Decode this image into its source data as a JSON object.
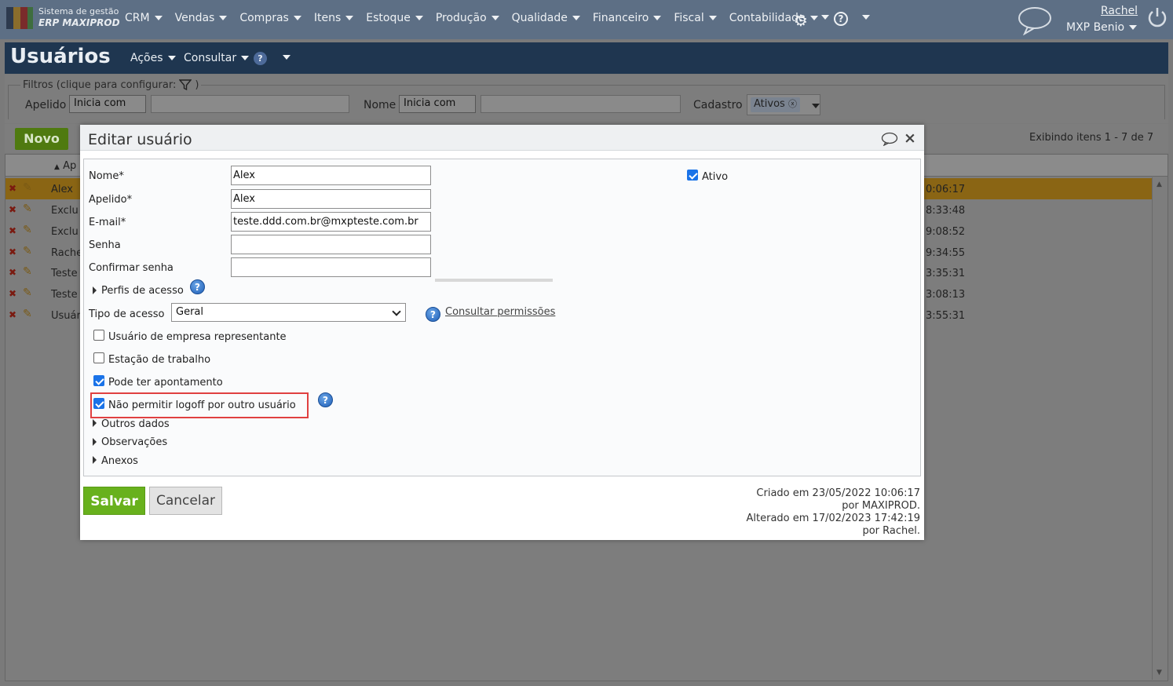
{
  "brand": {
    "line1": "Sistema de gestão",
    "line2": "ERP MAXIPROD"
  },
  "nav": [
    "CRM",
    "Vendas",
    "Compras",
    "Itens",
    "Estoque",
    "Produção",
    "Qualidade",
    "Financeiro",
    "Fiscal",
    "Contabilidade"
  ],
  "user": {
    "name": "Rachel",
    "company": "MXP Benio"
  },
  "page": {
    "title": "Usuários",
    "acoes": "Ações",
    "consultar": "Consultar"
  },
  "filters": {
    "legend": "Filtros (clique para configurar:",
    "legend_end": ")",
    "apelido_label": "Apelido",
    "apelido_op": "Inicia com",
    "nome_label": "Nome",
    "nome_op": "Inicia com",
    "cadastro_label": "Cadastro",
    "cadastro_tag": "Ativos"
  },
  "grid": {
    "novo": "Novo",
    "exibindo": "Exibindo itens 1 - 7 de 7",
    "sort_col": "Ap",
    "rows": [
      {
        "name": "Alex",
        "time": "0:06:17"
      },
      {
        "name": "Exclu",
        "time": "8:33:48"
      },
      {
        "name": "Exclu",
        "time": "9:08:52"
      },
      {
        "name": "Rache",
        "time": "9:34:55"
      },
      {
        "name": "Teste",
        "time": "3:35:31"
      },
      {
        "name": "Teste",
        "time": "3:08:13"
      },
      {
        "name": "Usuár",
        "time": "3:55:31"
      }
    ]
  },
  "modal": {
    "title": "Editar usuário",
    "fields": {
      "nome_label": "Nome*",
      "nome_value": "Alex",
      "apelido_label": "Apelido*",
      "apelido_value": "Alex",
      "email_label": "E-mail*",
      "email_value": "teste.ddd.com.br@mxpteste.com.br",
      "senha_label": "Senha",
      "senha_value": "",
      "confirmar_label": "Confirmar senha",
      "confirmar_value": ""
    },
    "ativo_label": "Ativo",
    "ativo_checked": true,
    "perfis_label": "Perfis de acesso",
    "tipo_label": "Tipo de acesso",
    "tipo_value": "Geral",
    "consultar_link": "Consultar permissões",
    "checks": [
      {
        "label": "Usuário de empresa representante",
        "checked": false
      },
      {
        "label": "Estação de trabalho",
        "checked": false
      },
      {
        "label": "Pode ter apontamento",
        "checked": true
      },
      {
        "label": "Não permitir logoff por outro usuário",
        "checked": true
      }
    ],
    "sections": [
      "Outros dados",
      "Observações",
      "Anexos"
    ],
    "salvar": "Salvar",
    "cancelar": "Cancelar",
    "meta": {
      "created": "Criado em 23/05/2022 10:06:17",
      "created_by": "por MAXIPROD.",
      "altered": "Alterado em 17/02/2023 17:42:19",
      "altered_by": "por Rachel."
    }
  },
  "colors": {
    "accent_green": "#68b11d",
    "highlight_red": "#e04040",
    "checkbox_blue": "#1a73e8"
  }
}
